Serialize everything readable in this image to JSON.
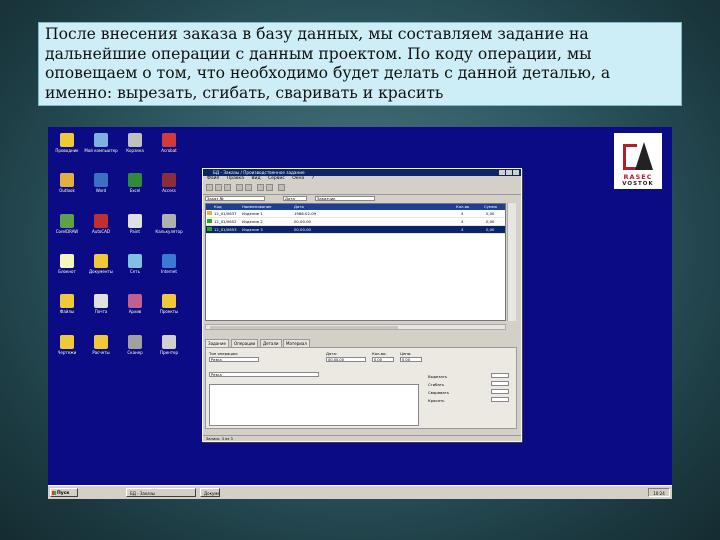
{
  "slide": {
    "caption": "После внесения заказа в базу данных, мы составляем задание на дальнейшие операции с данным проектом. По коду операции, мы оповещаем о том, что необходимо будет делать с данной деталью, а именно: вырезать, сгибать, сваривать и красить"
  },
  "logo": {
    "line1": "RASEC",
    "line2": "VOSTOK"
  },
  "desktop_icons": [
    {
      "label": "Проводник",
      "color": "#f0c93a"
    },
    {
      "label": "Мой компьютер",
      "color": "#7fb0e0"
    },
    {
      "label": "Корзина",
      "color": "#c0c0c0"
    },
    {
      "label": "Acrobat",
      "color": "#d23b3b"
    },
    {
      "label": "Outlook",
      "color": "#e0b040"
    },
    {
      "label": "Word",
      "color": "#3f6fc0"
    },
    {
      "label": "Excel",
      "color": "#2f8a3a"
    },
    {
      "label": "Access",
      "color": "#8a2f3a"
    },
    {
      "label": "CorelDRAW",
      "color": "#5fa04a"
    },
    {
      "label": "AutoCAD",
      "color": "#c03030"
    },
    {
      "label": "Paint",
      "color": "#e0e0e0"
    },
    {
      "label": "Калькулятор",
      "color": "#b0b0b0"
    },
    {
      "label": "Блокнот",
      "color": "#f5f5c0"
    },
    {
      "label": "Документы",
      "color": "#f0c93a"
    },
    {
      "label": "Сеть",
      "color": "#80c0e0"
    },
    {
      "label": "Internet",
      "color": "#3a7ad0"
    },
    {
      "label": "Файлы",
      "color": "#f0c93a"
    },
    {
      "label": "Почта",
      "color": "#e0e0e0"
    },
    {
      "label": "Архив",
      "color": "#c06090"
    },
    {
      "label": "Проекты",
      "color": "#f0c93a"
    },
    {
      "label": "Чертежи",
      "color": "#f0c93a"
    },
    {
      "label": "Расчеты",
      "color": "#f0c93a"
    },
    {
      "label": "Сканер",
      "color": "#a0a0a0"
    },
    {
      "label": "Принтер",
      "color": "#d0d0d0"
    }
  ],
  "app": {
    "title": "БД - Заказы / Производственное задание",
    "menu": [
      "Файл",
      "Правка",
      "Вид",
      "Сервис",
      "Окно",
      "?"
    ],
    "filter": {
      "order": "Заказ №",
      "date": "Дата",
      "client": "Заказчик"
    },
    "grid_headers": [
      "Код",
      "Наименование",
      "Дата",
      "Кол-во",
      "Сумма"
    ],
    "rows": [
      {
        "code": "12_01/0637",
        "name": "Изделие 1",
        "date": "1988-02-09",
        "qty": "4",
        "sum": "0,00",
        "selected": false
      },
      {
        "code": "12_01/0652",
        "name": "Изделие 2",
        "date": "00.00.00",
        "qty": "4",
        "sum": "0,00",
        "selected": false
      },
      {
        "code": "12_01/0653",
        "name": "Изделие 3",
        "date": "00.00.00",
        "qty": "4",
        "sum": "0,00",
        "selected": true
      }
    ],
    "tabs": [
      "Задание",
      "Операции",
      "Детали",
      "Материал"
    ],
    "detail": {
      "type_label": "Тип операции:",
      "type_value": "Резка",
      "date_label": "Дата:",
      "date_value": "00.00.00",
      "count_label": "Кол-во:",
      "count_value": "0,00",
      "price_label": "Цена:",
      "price_value": "0,00",
      "right_labels": [
        "Вырезать",
        "Сгибать",
        "Сваривать",
        "Красить"
      ]
    },
    "status": "Запись: 3 из 3"
  },
  "taskbar": {
    "start": "Пуск",
    "tasks": [
      "БД - Заказы",
      "Документ"
    ],
    "clock": "10:24"
  }
}
